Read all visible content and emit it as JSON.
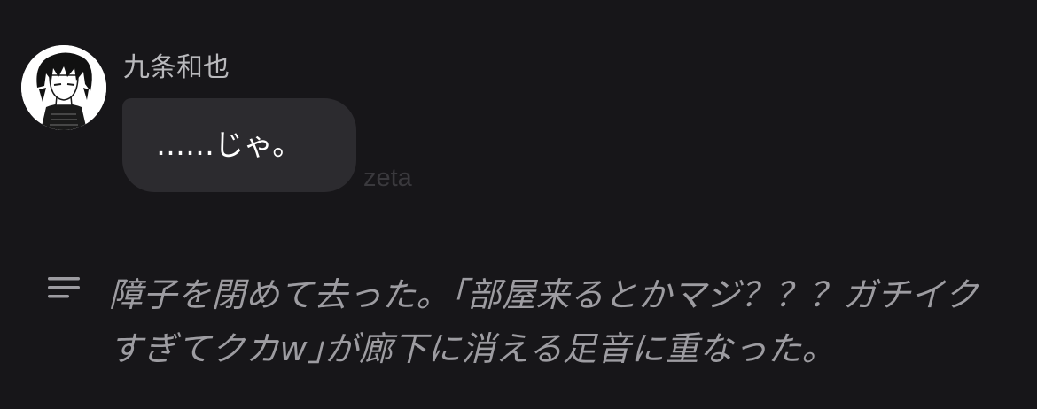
{
  "message": {
    "sender_name": "九条和也",
    "avatar_icon": "character-avatar-icon",
    "text": "……じゃ。",
    "bubble_color": "#2c2b2f"
  },
  "watermark": {
    "text": "zeta"
  },
  "narration": {
    "icon": "narration-lines-icon",
    "text": "障子を閉めて去った。｢部屋来るとかマジ？？？ガチイクすぎてクカw｣が廊下に消える足音に重なった。",
    "color": "#9d9ca1"
  },
  "background_color": "#171619"
}
